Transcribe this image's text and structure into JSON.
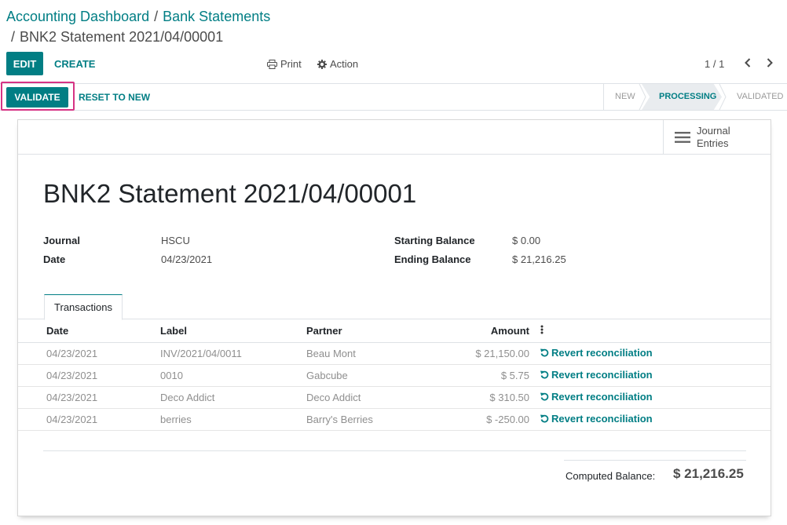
{
  "breadcrumb": {
    "items": [
      "Accounting Dashboard",
      "Bank Statements"
    ],
    "separator": "/",
    "current": "BNK2 Statement 2021/04/00001"
  },
  "control": {
    "edit_label": "EDIT",
    "create_label": "CREATE",
    "print_label": "Print",
    "action_label": "Action",
    "pager": "1 / 1"
  },
  "statusbar": {
    "validate_label": "VALIDATE",
    "reset_label": "RESET TO NEW",
    "stages": [
      "NEW",
      "PROCESSING",
      "VALIDATED"
    ],
    "current_stage": "PROCESSING"
  },
  "smart_button": {
    "line1": "Journal",
    "line2": "Entries"
  },
  "record": {
    "title": "BNK2 Statement 2021/04/00001",
    "journal_label": "Journal",
    "journal_value": "HSCU",
    "date_label": "Date",
    "date_value": "04/23/2021",
    "start_label": "Starting Balance",
    "start_value": "$ 0.00",
    "end_label": "Ending Balance",
    "end_value": "$ 21,216.25"
  },
  "tabs": [
    "Transactions"
  ],
  "table": {
    "columns": [
      "Date",
      "Label",
      "Partner",
      "Amount"
    ],
    "rows": [
      {
        "date": "04/23/2021",
        "label": "INV/2021/04/0011",
        "partner": "Beau Mont",
        "amount": "$ 21,150.00",
        "action": "Revert reconciliation"
      },
      {
        "date": "04/23/2021",
        "label": "0010",
        "partner": "Gabcube",
        "amount": "$ 5.75",
        "action": "Revert reconciliation"
      },
      {
        "date": "04/23/2021",
        "label": "Deco Addict",
        "partner": "Deco Addict",
        "amount": "$ 310.50",
        "action": "Revert reconciliation"
      },
      {
        "date": "04/23/2021",
        "label": "berries",
        "partner": "Barry's Berries",
        "amount": "$ -250.00",
        "action": "Revert reconciliation"
      }
    ]
  },
  "totals": {
    "label": "Computed Balance:",
    "value": "$ 21,216.25"
  },
  "colors": {
    "accent": "#017e84",
    "highlight": "#d63384"
  }
}
